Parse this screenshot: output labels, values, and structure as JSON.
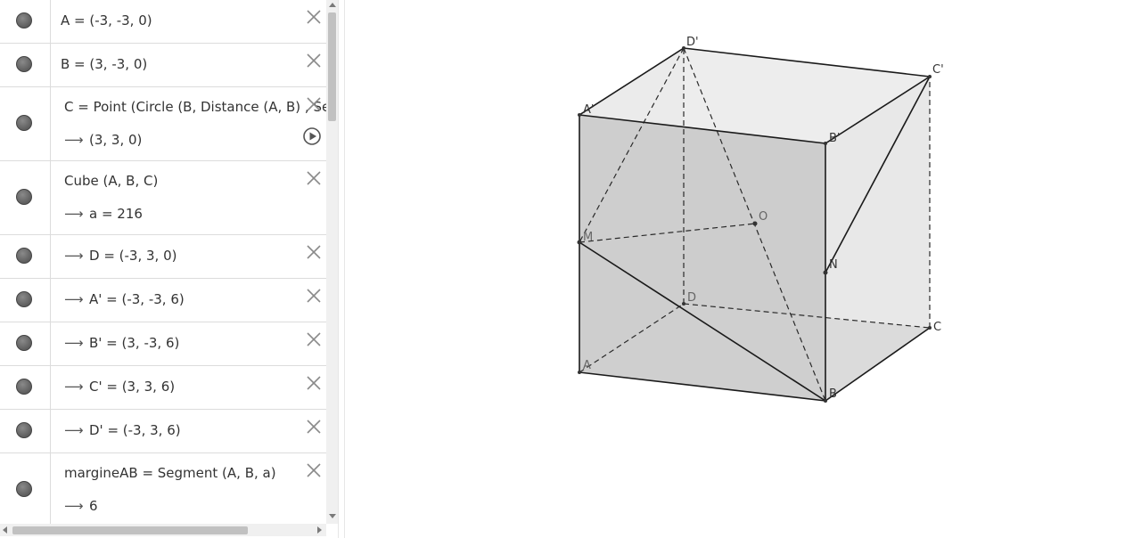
{
  "algebra_view": {
    "rows": [
      {
        "id": "A",
        "lines": [
          {
            "arrow": false,
            "text": "A = (-3, -3, 0)"
          }
        ],
        "closable": true,
        "play": false
      },
      {
        "id": "B",
        "lines": [
          {
            "arrow": false,
            "text": "B = (3, -3, 0)"
          }
        ],
        "closable": true,
        "play": false
      },
      {
        "id": "C",
        "lines": [
          {
            "arrow": false,
            "text": "C = Point (Circle (B, Distance (A, B) , Segment (A, B)))"
          },
          {
            "arrow": true,
            "text": "(3, 3, 0)"
          }
        ],
        "closable": true,
        "play": true
      },
      {
        "id": "cube",
        "lines": [
          {
            "arrow": false,
            "text": "Cube (A, B, C)"
          },
          {
            "arrow": true,
            "text": "a = 216"
          }
        ],
        "closable": true,
        "play": false
      },
      {
        "id": "D",
        "lines": [
          {
            "arrow": true,
            "text": "D = (-3, 3, 0)"
          }
        ],
        "closable": true,
        "play": false
      },
      {
        "id": "A1",
        "lines": [
          {
            "arrow": true,
            "text": "A' = (-3, -3, 6)"
          }
        ],
        "closable": true,
        "play": false
      },
      {
        "id": "B1",
        "lines": [
          {
            "arrow": true,
            "text": "B' = (3, -3, 6)"
          }
        ],
        "closable": true,
        "play": false
      },
      {
        "id": "C1",
        "lines": [
          {
            "arrow": true,
            "text": "C' = (3, 3, 6)"
          }
        ],
        "closable": true,
        "play": false
      },
      {
        "id": "D1",
        "lines": [
          {
            "arrow": true,
            "text": "D' = (-3, 3, 6)"
          }
        ],
        "closable": true,
        "play": false
      },
      {
        "id": "margineAB",
        "lines": [
          {
            "arrow": false,
            "text": "margineAB = Segment (A, B, a)"
          },
          {
            "arrow": true,
            "text": "6"
          }
        ],
        "closable": true,
        "play": false
      }
    ],
    "arrow_glyph": "⟶"
  },
  "graphics_view": {
    "labels": {
      "A": "A",
      "B": "B",
      "C": "C",
      "D": "D",
      "A1": "A'",
      "B1": "B'",
      "C1": "C'",
      "D1": "D'",
      "M": "M",
      "N": "N",
      "O": "O"
    },
    "colors": {
      "edge": "#1a1a1a",
      "front_face": "#c9c9c9",
      "side_face": "#dedede",
      "top_face": "#e8e8e8",
      "marble": "#6e6e6e"
    }
  }
}
